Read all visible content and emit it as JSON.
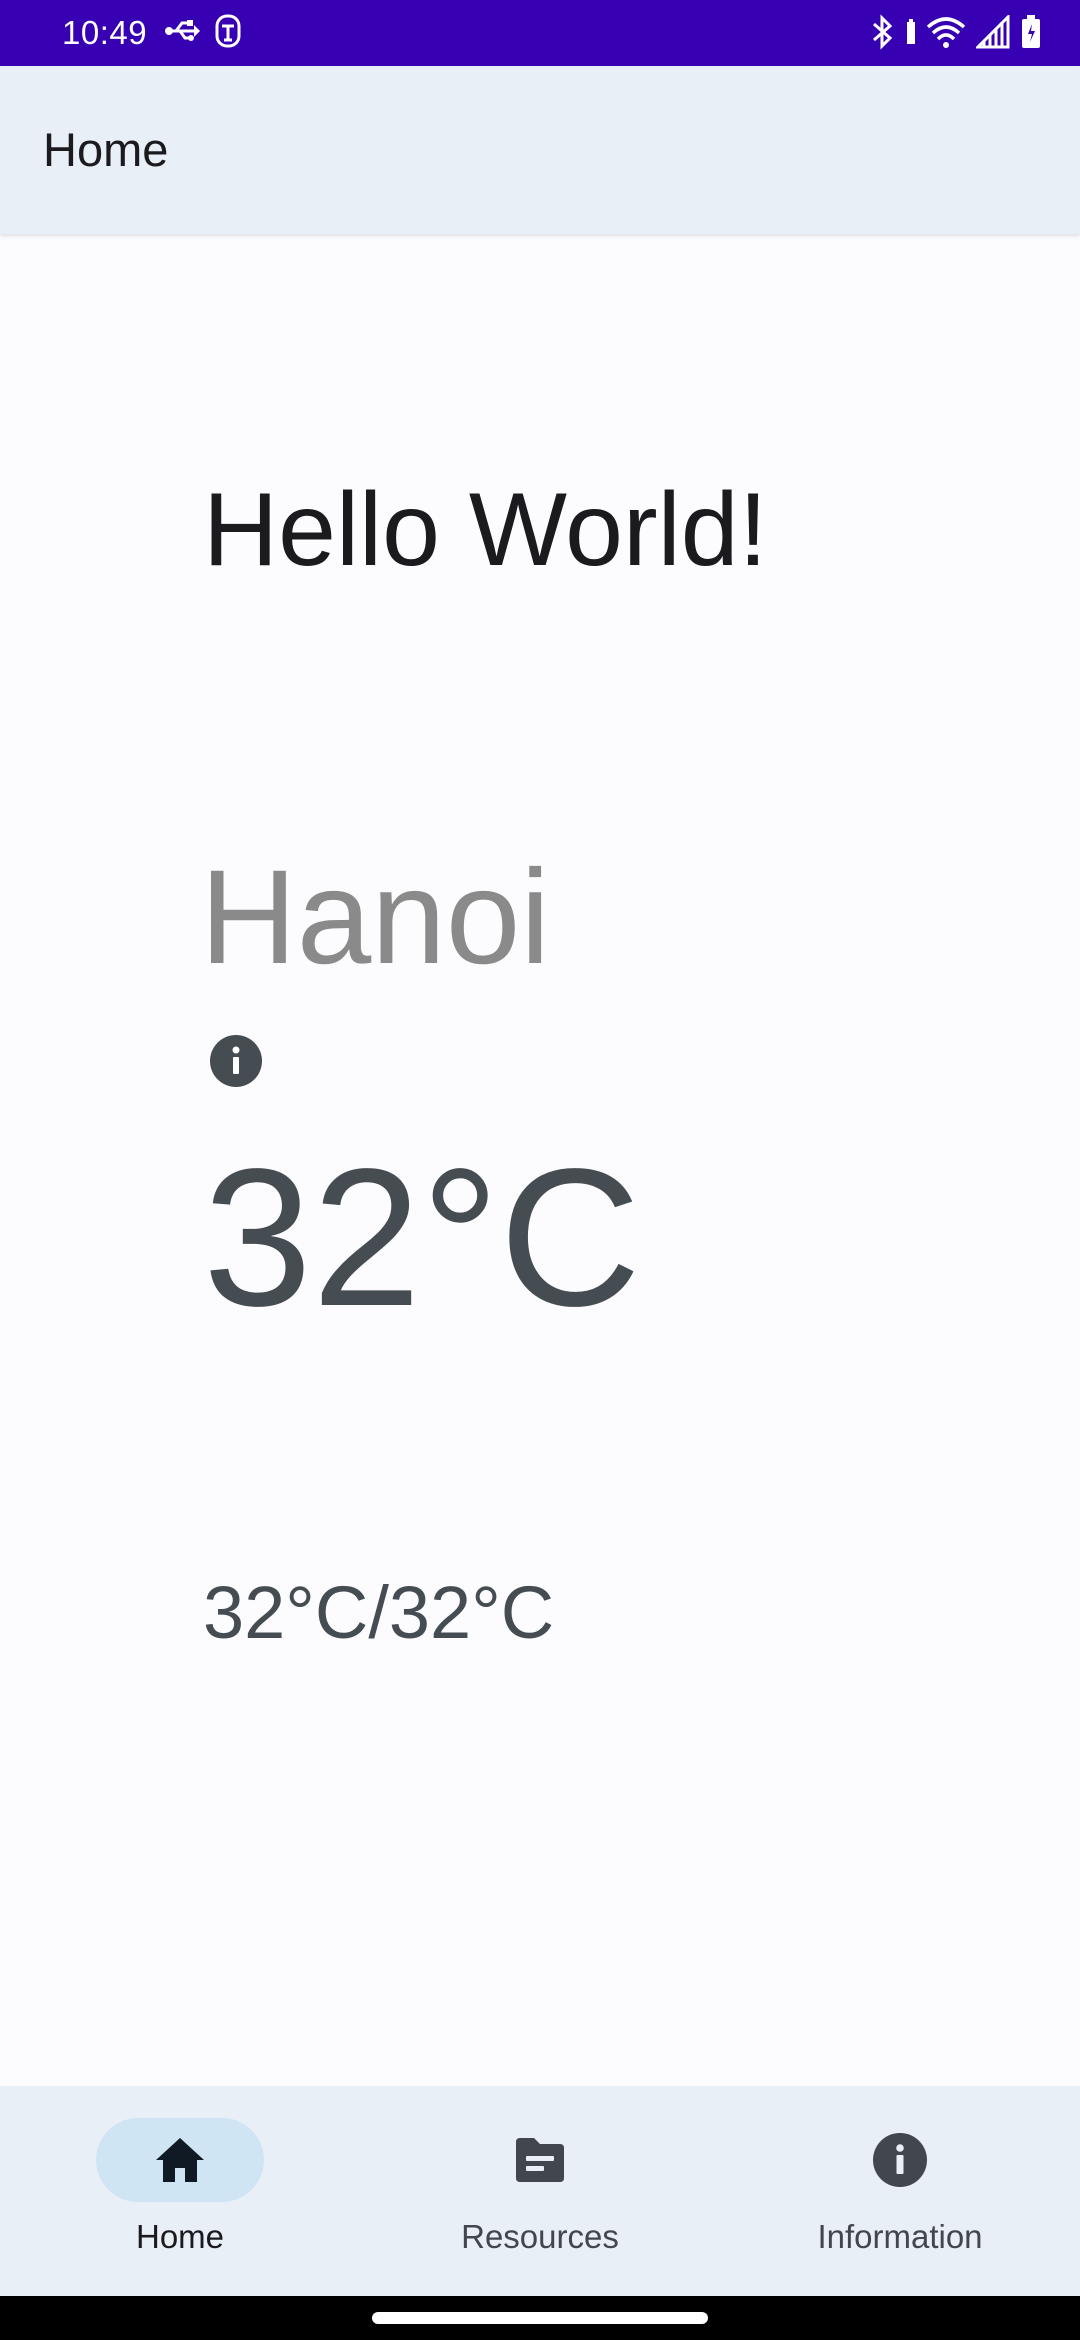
{
  "status_bar": {
    "time": "10:49",
    "background": "#3700b3",
    "left_icons": [
      "usb-icon",
      "accessibility-icon"
    ],
    "right_icons": [
      "bluetooth-icon",
      "wifi-icon",
      "signal-icon",
      "battery-icon"
    ]
  },
  "app_bar": {
    "title": "Home"
  },
  "content": {
    "greeting": "Hello World!",
    "city": "Hanoi",
    "temperature": "32°C",
    "temperature_range": "32°C/32°C",
    "info_icon": "info-icon"
  },
  "bottom_nav": {
    "items": [
      {
        "label": "Home",
        "icon": "home-icon",
        "active": true
      },
      {
        "label": "Resources",
        "icon": "folder-icon",
        "active": false
      },
      {
        "label": "Information",
        "icon": "info-icon",
        "active": false
      }
    ],
    "active_color": "#cfe5f3"
  }
}
